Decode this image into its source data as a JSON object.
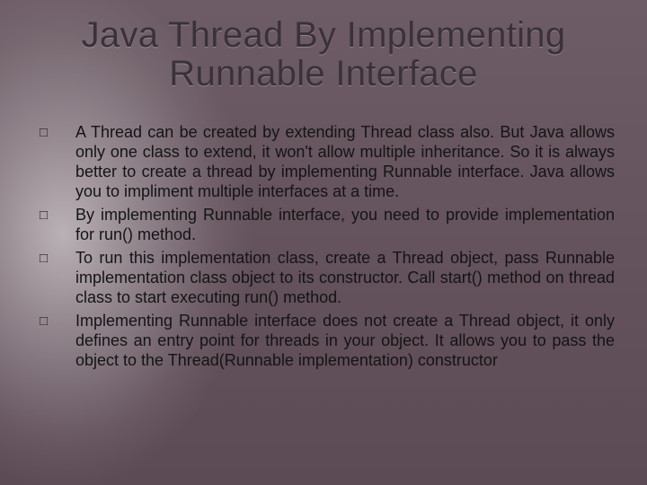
{
  "slide": {
    "title_line1": "Java Thread By Implementing",
    "title_line2": "Runnable Interface",
    "bullet_glyph": "□",
    "bullets": [
      "A Thread can be created by extending Thread class also. But Java allows only one class to extend, it won't allow multiple inheritance. So it is always better to create a thread by implementing Runnable interface. Java allows you to impliment multiple interfaces at a time.",
      "By implementing Runnable interface, you need to provide implementation for run() method.",
      "To run this implementation class, create a Thread object, pass Runnable implementation class object to its constructor. Call start() method on thread class to start executing run() method.",
      "Implementing Runnable interface does not create a Thread object, it only defines an entry point for threads in your object. It allows you to pass the object to the Thread(Runnable implementation) constructor"
    ]
  }
}
